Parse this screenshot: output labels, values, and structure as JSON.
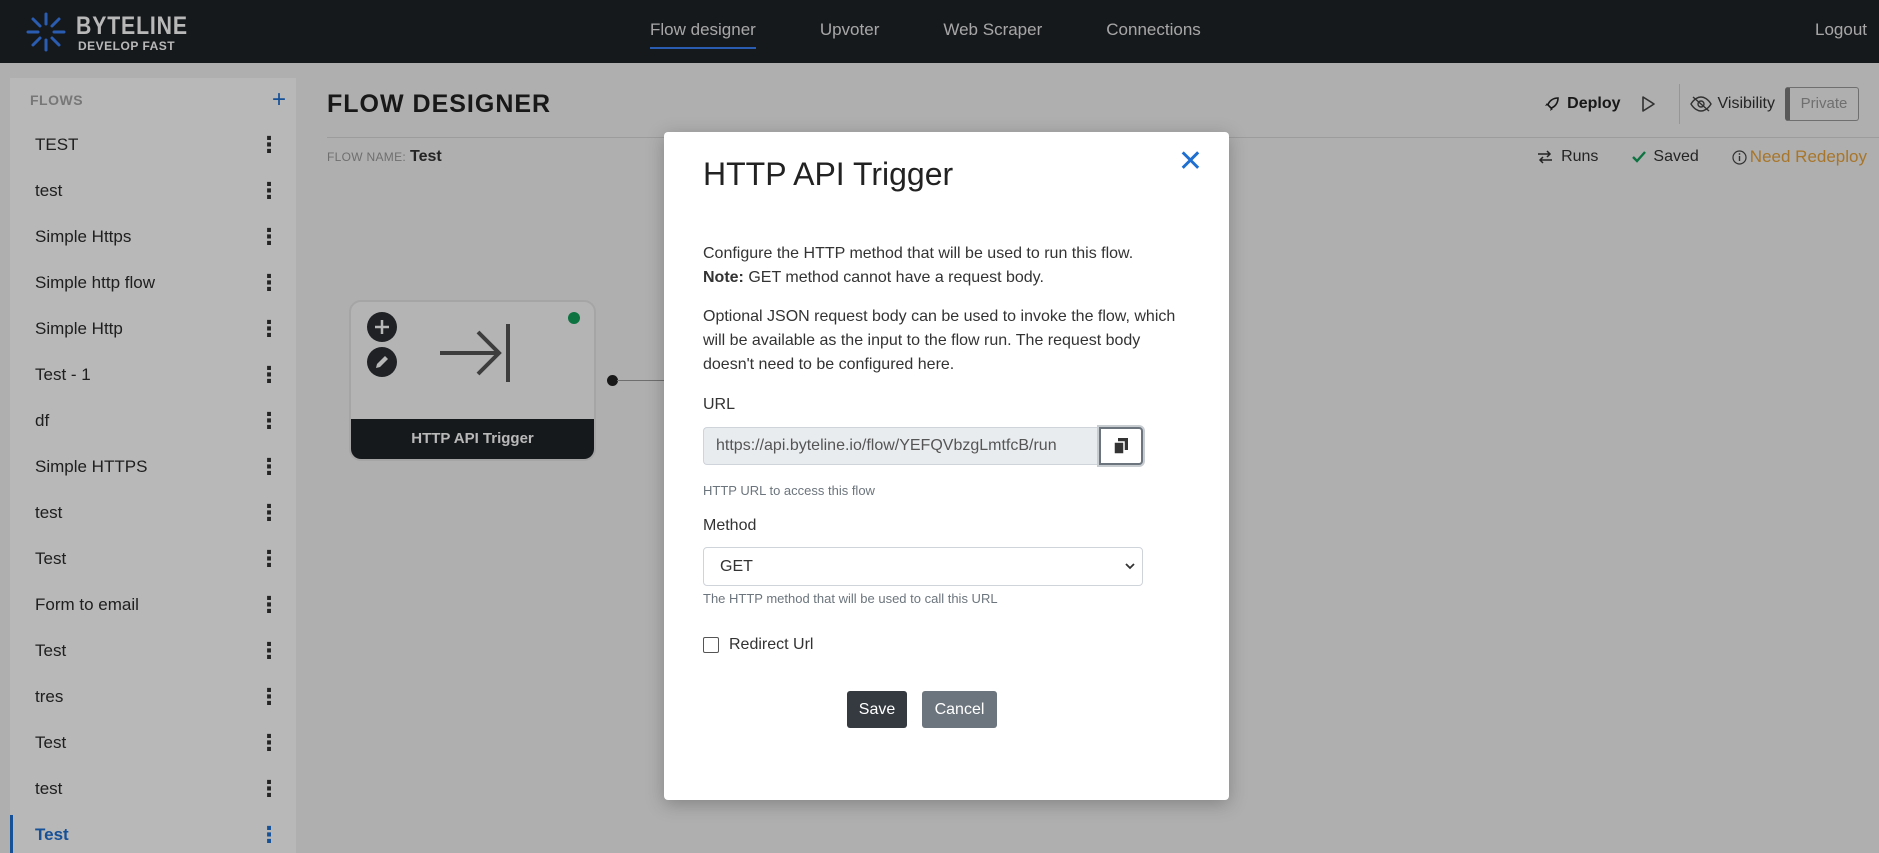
{
  "nav": {
    "logo_title": "BYTELINE",
    "logo_subtitle": "DEVELOP FAST",
    "links": [
      {
        "label": "Flow designer",
        "active": true
      },
      {
        "label": "Upvoter",
        "active": false
      },
      {
        "label": "Web Scraper",
        "active": false
      },
      {
        "label": "Connections",
        "active": false
      }
    ],
    "logout": "Logout"
  },
  "sidebar": {
    "header": "FLOWS",
    "add_icon": "plus-icon",
    "items": [
      {
        "label": "TEST"
      },
      {
        "label": "test"
      },
      {
        "label": "Simple Https"
      },
      {
        "label": "Simple http flow"
      },
      {
        "label": "Simple Http"
      },
      {
        "label": "Test - 1"
      },
      {
        "label": "df"
      },
      {
        "label": "Simple HTTPS"
      },
      {
        "label": "test"
      },
      {
        "label": "Test"
      },
      {
        "label": "Form to email"
      },
      {
        "label": "Test"
      },
      {
        "label": "tres"
      },
      {
        "label": "Test"
      },
      {
        "label": "test"
      },
      {
        "label": "Test",
        "active": true
      }
    ]
  },
  "main": {
    "title": "FLOW DESIGNER",
    "toolbar": {
      "deploy": "Deploy",
      "visibility": "Visibility",
      "private": "Private"
    },
    "flow_name_label": "FLOW NAME:",
    "flow_name": "Test",
    "status": {
      "runs": "Runs",
      "saved": "Saved",
      "need_redeploy": "Need Redeploy"
    },
    "node": {
      "label": "HTTP API Trigger"
    }
  },
  "modal": {
    "title": "HTTP API Trigger",
    "description_line1": "Configure the HTTP method that will be used to run this flow.",
    "note_label": "Note:",
    "note_text": " GET method cannot have a request body.",
    "description_p2": "Optional JSON request body can be used to invoke the flow, which will be available as the input to the flow run. The request body doesn't need to be configured here.",
    "url_label": "URL",
    "url_value": "https://api.byteline.io/flow/YEFQVbzgLmtfcB/run",
    "url_help": "HTTP URL to access this flow",
    "method_label": "Method",
    "method_value": "GET",
    "method_help": "The HTTP method that will be used to call this URL",
    "redirect_label": "Redirect Url",
    "redirect_checked": false,
    "save": "Save",
    "cancel": "Cancel"
  },
  "colors": {
    "nav_bg": "#1f2327",
    "accent": "#1f6fd1",
    "warning": "#e9a43b",
    "success": "#12a05a"
  }
}
